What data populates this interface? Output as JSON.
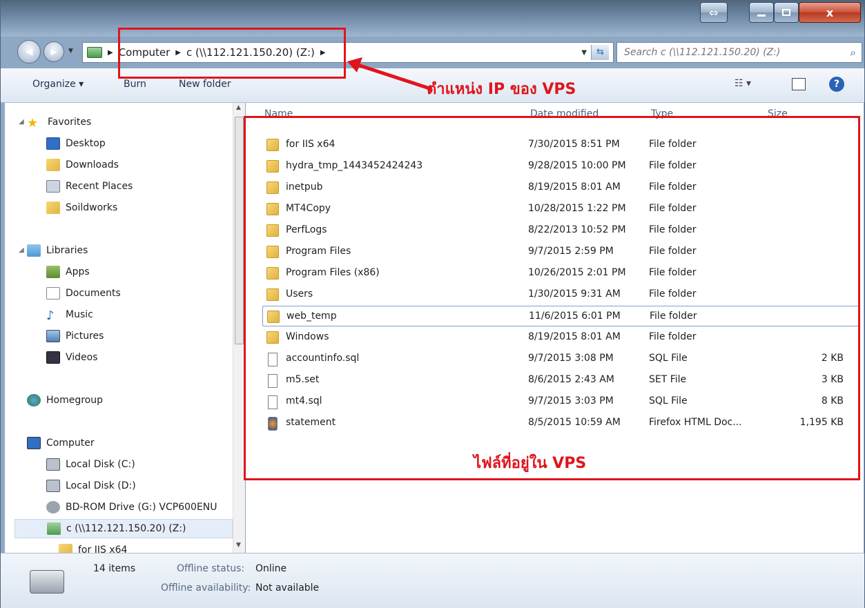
{
  "address": {
    "crumbs": [
      "Computer",
      "c (\\\\112.121.150.20) (Z:)"
    ]
  },
  "search": {
    "placeholder": "Search c (\\\\112.121.150.20) (Z:)"
  },
  "toolbar": {
    "organize": "Organize ▾",
    "burn": "Burn",
    "new_folder": "New folder"
  },
  "annotations": {
    "ip_label": "ตำแหน่ง IP ของ VPS",
    "files_label": "ไฟล์ที่อยู่ใน VPS"
  },
  "nav": {
    "favorites": "Favorites",
    "desktop": "Desktop",
    "downloads": "Downloads",
    "recent": "Recent Places",
    "soildworks": "Soildworks",
    "libraries": "Libraries",
    "apps": "Apps",
    "documents": "Documents",
    "music": "Music",
    "pictures": "Pictures",
    "videos": "Videos",
    "homegroup": "Homegroup",
    "computer": "Computer",
    "local_c": "Local Disk (C:)",
    "local_d": "Local Disk (D:)",
    "bdrom": "BD-ROM Drive (G:) VCP600ENU",
    "netdrive": "c (\\\\112.121.150.20) (Z:)",
    "forIIS": "for IIS x64"
  },
  "columns": {
    "name": "Name",
    "date": "Date modified",
    "type": "Type",
    "size": "Size"
  },
  "files": [
    {
      "name": "for IIS x64",
      "date": "7/30/2015 8:51 PM",
      "type": "File folder",
      "size": ""
    },
    {
      "name": "hydra_tmp_1443452424243",
      "date": "9/28/2015 10:00 PM",
      "type": "File folder",
      "size": ""
    },
    {
      "name": "inetpub",
      "date": "8/19/2015 8:01 AM",
      "type": "File folder",
      "size": ""
    },
    {
      "name": "MT4Copy",
      "date": "10/28/2015 1:22 PM",
      "type": "File folder",
      "size": ""
    },
    {
      "name": "PerfLogs",
      "date": "8/22/2013 10:52 PM",
      "type": "File folder",
      "size": ""
    },
    {
      "name": "Program Files",
      "date": "9/7/2015 2:59 PM",
      "type": "File folder",
      "size": ""
    },
    {
      "name": "Program Files (x86)",
      "date": "10/26/2015 2:01 PM",
      "type": "File folder",
      "size": ""
    },
    {
      "name": "Users",
      "date": "1/30/2015 9:31 AM",
      "type": "File folder",
      "size": ""
    },
    {
      "name": "web_temp",
      "date": "11/6/2015 6:01 PM",
      "type": "File folder",
      "size": ""
    },
    {
      "name": "Windows",
      "date": "8/19/2015 8:01 AM",
      "type": "File folder",
      "size": ""
    },
    {
      "name": "accountinfo.sql",
      "date": "9/7/2015 3:08 PM",
      "type": "SQL File",
      "size": "2 KB"
    },
    {
      "name": "m5.set",
      "date": "8/6/2015 2:43 AM",
      "type": "SET File",
      "size": "3 KB"
    },
    {
      "name": "mt4.sql",
      "date": "9/7/2015 3:03 PM",
      "type": "SQL File",
      "size": "8 KB"
    },
    {
      "name": "statement",
      "date": "8/5/2015 10:59 AM",
      "type": "Firefox HTML Doc...",
      "size": "1,195 KB"
    }
  ],
  "status": {
    "count": "14 items",
    "offline_status_label": "Offline status:",
    "offline_status_value": "Online",
    "offline_avail_label": "Offline availability:",
    "offline_avail_value": "Not available"
  }
}
